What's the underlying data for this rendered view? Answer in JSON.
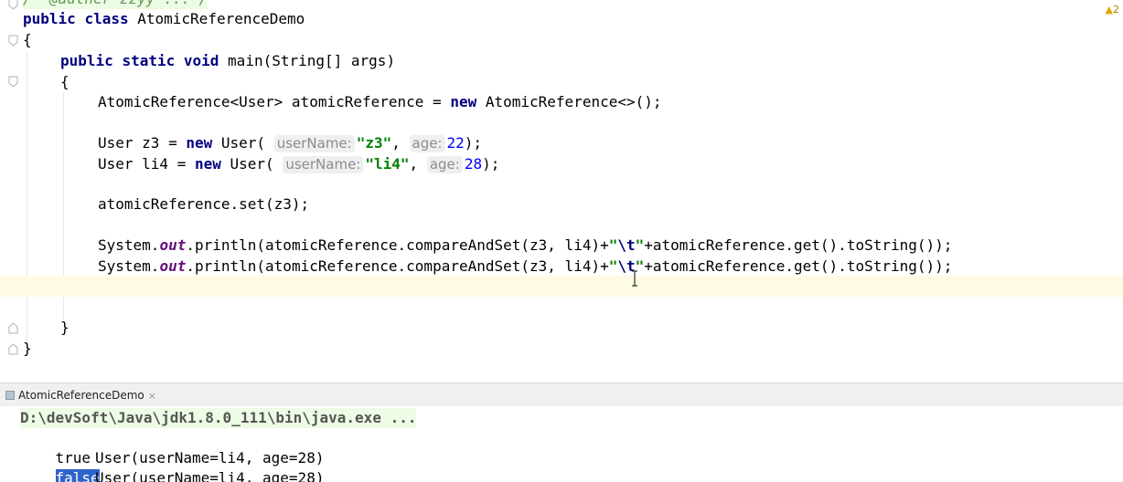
{
  "editor": {
    "comment_line": "/  @auther zzyy ... /",
    "warning_count": "2",
    "lines": {
      "class_decl": {
        "kw1": "public",
        "kw2": "class",
        "name": "AtomicReferenceDemo"
      },
      "open_brace": "{",
      "main_decl": {
        "kw1": "public",
        "kw2": "static",
        "kw3": "void",
        "rest": "main(String[] args)"
      },
      "main_open": "{",
      "ref_decl": {
        "a": "AtomicReference<User> atomicReference = ",
        "kw": "new",
        "b": "AtomicReference<>();"
      },
      "z3_decl": {
        "a": "User z3 = ",
        "kw": "new",
        "b": "User(",
        "hint1": "userName:",
        "s": "\"z3\"",
        "c": ",",
        "hint2": "age:",
        "n": "22",
        "d": ");"
      },
      "li4_decl": {
        "a": "User li4 = ",
        "kw": "new",
        "b": "User(",
        "hint1": "userName:",
        "s": "\"li4\"",
        "c": ",",
        "hint2": "age:",
        "n": "28",
        "d": ");"
      },
      "set_call": "atomicReference.set(z3);",
      "print1": {
        "a": "System.",
        "field": "out",
        "b": ".println(atomicReference.compareAndSet(z3, li4)+",
        "s1": "\"",
        "esc": "\\t",
        "s2": "\"",
        "c": "+atomicReference.get().toString());"
      },
      "print2": {
        "a": "System.",
        "field": "out",
        "b": ".println(atomicReference.compareAndSet(z3, li4)+",
        "s1": "\"",
        "esc": "\\t",
        "s2": "\"",
        "c": "+atomicReference.get().toString());"
      },
      "main_close": "}",
      "class_close": "}"
    }
  },
  "run_window": {
    "tab_label": "AtomicReferenceDemo",
    "tab_close": "×",
    "command": "D:\\devSoft\\Java\\jdk1.8.0_111\\bin\\java.exe ...",
    "output": [
      {
        "result": "true",
        "value": "User(userName=li4, age=28)"
      },
      {
        "result": "false",
        "value": "User(userName=li4, age=28)"
      }
    ]
  },
  "colors": {
    "keyword": "#000080",
    "string": "#008000",
    "number": "#0000ff",
    "static_field": "#660e7a",
    "current_line": "#fffae3",
    "selection": "#2f65ca"
  }
}
